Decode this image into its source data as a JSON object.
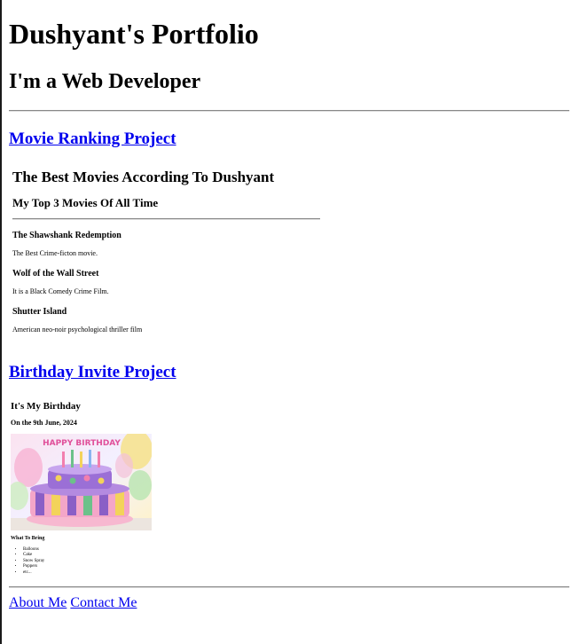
{
  "header": {
    "title": "Dushyant's Portfolio",
    "subtitle": "I'm a Web Developer"
  },
  "projects": {
    "movie": {
      "link_label": "Movie Ranking Project",
      "heading": "The Best Movies According To Dushyant",
      "subheading": "My Top 3 Movies Of All Time",
      "movies": [
        {
          "name": "The Shawshank Redemption",
          "description": "The Best Crime-ficton movie."
        },
        {
          "name": "Wolf of the Wall Street",
          "description": "It is a Black Comedy Crime Film."
        },
        {
          "name": "Shutter Island",
          "description": "American neo-noir psychological thriller film"
        }
      ]
    },
    "birthday": {
      "link_label": "Birthday Invite Project",
      "heading": "It's My Birthday",
      "date": "On the 9th June, 2024",
      "image_text": "HAPPY BIRTHDAY",
      "bring_heading": "What To Bring",
      "items": [
        "Balloons",
        "Cake",
        "Snow Spray",
        "Poppers",
        "etc..."
      ]
    }
  },
  "footer": {
    "about_label": "About Me",
    "contact_label": "Contact Me"
  },
  "colors": {
    "link": "#0000ee",
    "rule": "#888888",
    "cake_purple": "#8a5fc6",
    "cake_pink": "#f4a6c8"
  }
}
